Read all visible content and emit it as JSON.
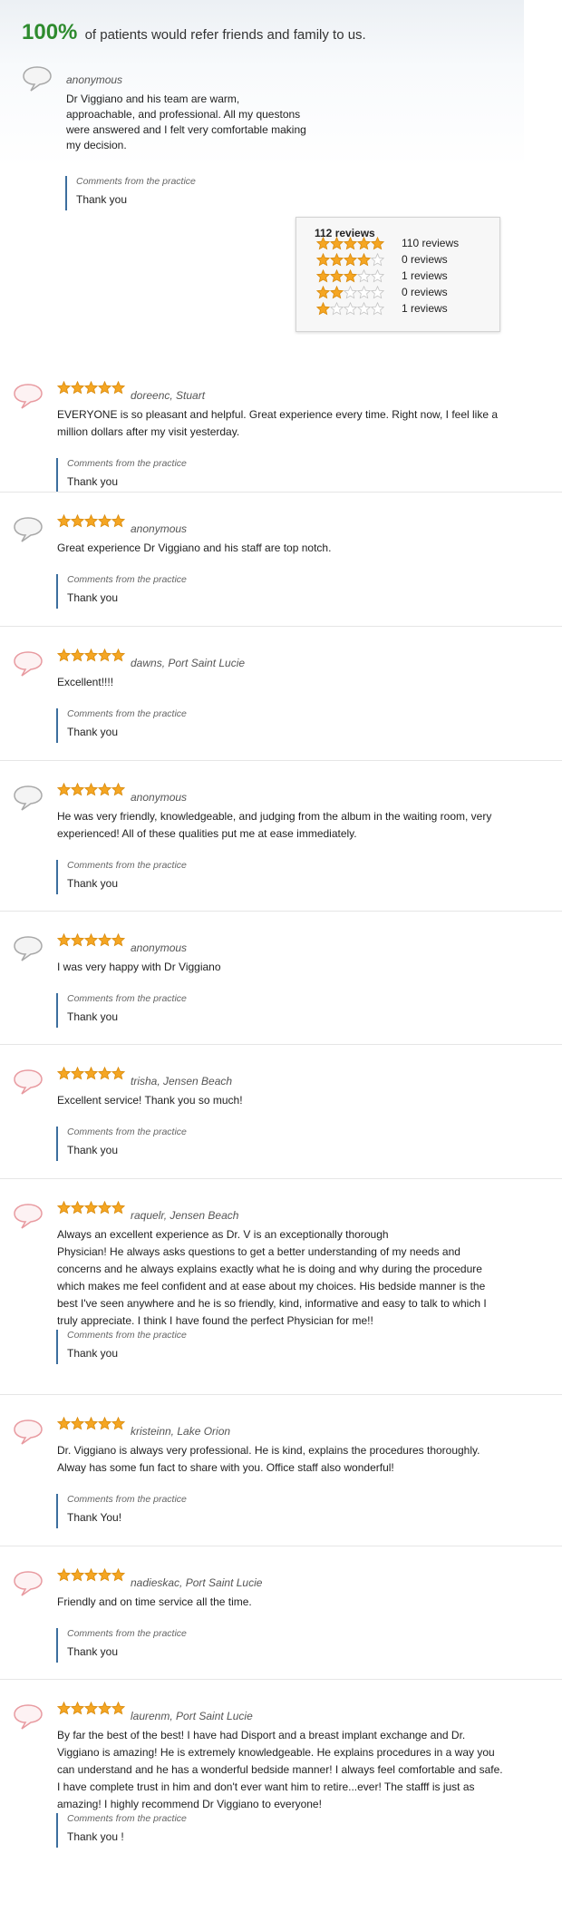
{
  "header": {
    "percent": "100%",
    "text": "of patients would refer friends and family to us."
  },
  "featured": {
    "author": "anonymous",
    "text": "Dr Viggiano and his team are warm, approachable, and professional. All my questons were answered and I felt very comfortable making my decision.",
    "comment_label": "Comments from the practice",
    "comment_text": "Thank you"
  },
  "summary": {
    "total": "112 reviews",
    "rows": [
      {
        "stars": 5,
        "count": "110 reviews"
      },
      {
        "stars": 4,
        "count": "0 reviews"
      },
      {
        "stars": 3,
        "count": "1 reviews"
      },
      {
        "stars": 2,
        "count": "0 reviews"
      },
      {
        "stars": 1,
        "count": "1 reviews"
      }
    ]
  },
  "colors": {
    "accent_green": "#2e8b2e",
    "star_gold": "#f5a623",
    "comment_bar": "#3c6e9e",
    "bubble_pink": "#e89aa0",
    "bubble_gray": "#a8a8a8"
  },
  "reviews": [
    {
      "author": "doreenc, Stuart",
      "rating": 5,
      "bubble": "pink",
      "text": "EVERYONE is so pleasant and helpful. Great experience every time. Right now, I feel like a million dollars after my visit yesterday.",
      "comment_label": "Comments from the practice",
      "comment_text": "Thank you"
    },
    {
      "author": "anonymous",
      "rating": 5,
      "bubble": "gray",
      "text": "Great experience Dr Viggiano and his staff are top notch.",
      "comment_label": "Comments from the practice",
      "comment_text": "Thank you"
    },
    {
      "author": "dawns, Port Saint Lucie",
      "rating": 5,
      "bubble": "pink",
      "text": "Excellent!!!!",
      "comment_label": "Comments from the practice",
      "comment_text": "Thank you"
    },
    {
      "author": "anonymous",
      "rating": 5,
      "bubble": "gray",
      "text": "He was very friendly, knowledgeable, and judging from the album in the waiting room, very experienced! All of these qualities put me at ease immediately.",
      "comment_label": "Comments from the practice",
      "comment_text": "Thank you"
    },
    {
      "author": "anonymous",
      "rating": 5,
      "bubble": "gray",
      "text": "I was very happy with Dr Viggiano",
      "comment_label": "Comments from the practice",
      "comment_text": "Thank you"
    },
    {
      "author": "trisha, Jensen Beach",
      "rating": 5,
      "bubble": "pink",
      "text": "Excellent service! Thank you so much!",
      "comment_label": "Comments from the practice",
      "comment_text": "Thank you"
    },
    {
      "author": "raquelr, Jensen Beach",
      "rating": 5,
      "bubble": "pink",
      "text": "Always an excellent experience as Dr. V is an exceptionally thorough\nPhysician! He always asks questions to get a better understanding of my needs and concerns and he always explains exactly what he is doing and why during the procedure which makes me feel confident and at ease about my choices. His bedside manner is the best I've seen anywhere and he is so friendly, kind, informative and easy to talk to which I truly appreciate. I think I have found the perfect Physician for me!!",
      "comment_label": "Comments from the practice",
      "comment_text": "Thank you"
    },
    {
      "author": "kristeinn, Lake Orion",
      "rating": 5,
      "bubble": "pink",
      "text": "Dr. Viggiano is always very professional. He is kind, explains the procedures thoroughly. Alway has some fun fact to share with you. Office staff also wonderful!",
      "comment_label": "Comments from the practice",
      "comment_text": "Thank You!"
    },
    {
      "author": "nadieskac, Port Saint Lucie",
      "rating": 5,
      "bubble": "pink",
      "text": "Friendly and on time service all the time.",
      "comment_label": "Comments from the practice",
      "comment_text": "Thank you"
    },
    {
      "author": "laurenm, Port Saint Lucie",
      "rating": 5,
      "bubble": "pink",
      "text": "By far the best of the best! I have had Disport and a breast implant exchange and Dr. Viggiano is amazing! He is extremely knowledgeable. He explains procedures in a way you can understand and he has a wonderful bedside manner! I always feel comfortable and safe. I have complete trust in him and don't ever want him to retire...ever! The stafff is just as amazing! I highly recommend Dr Viggiano to everyone!",
      "comment_label": "Comments from the practice",
      "comment_text": "Thank you !"
    }
  ]
}
